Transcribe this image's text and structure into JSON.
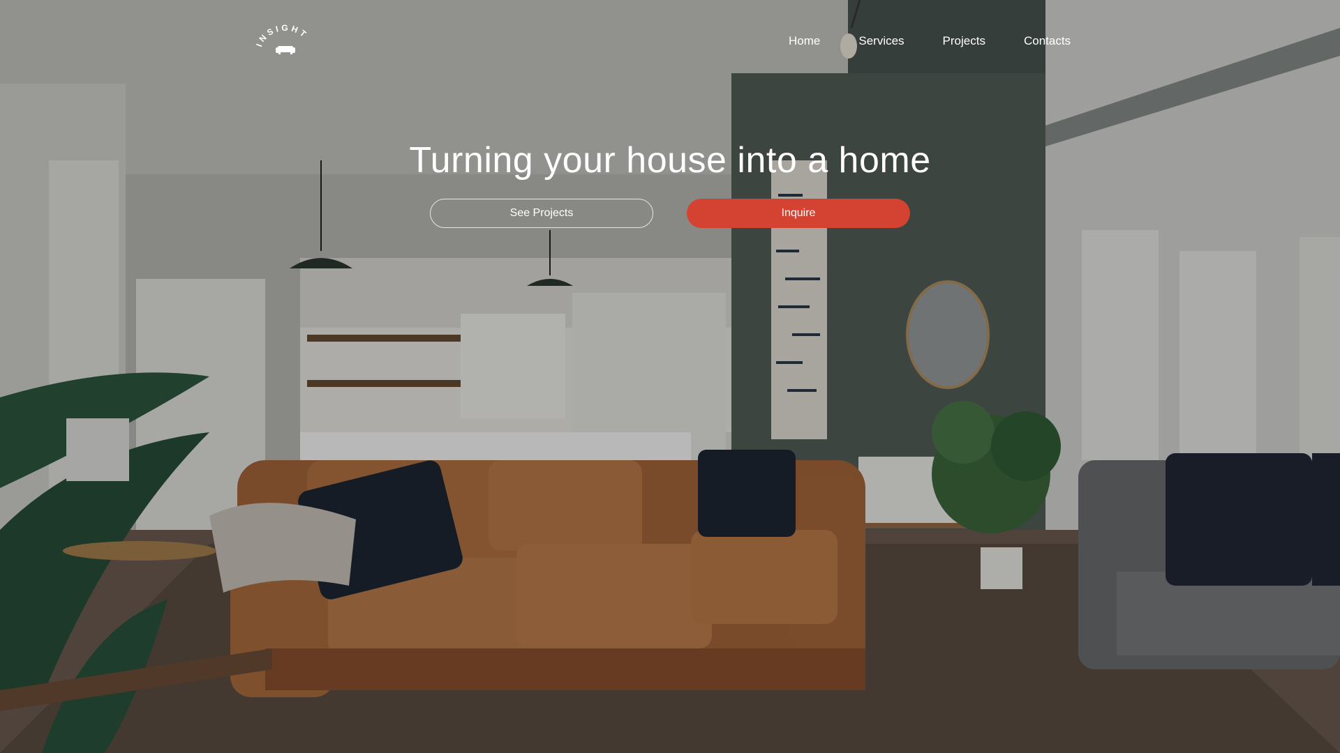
{
  "brand": {
    "logo_text": "INSIGHT",
    "logo_icon": "sofa-icon"
  },
  "nav": {
    "items": [
      {
        "label": "Home"
      },
      {
        "label": "Services"
      },
      {
        "label": "Projects"
      },
      {
        "label": "Contacts"
      }
    ]
  },
  "hero": {
    "headline": "Turning your house into a home",
    "secondary_button": "See Projects",
    "primary_button": "Inquire",
    "background_image": "living-room-photo"
  },
  "colors": {
    "accent": "#d44232",
    "text": "#ffffff",
    "overlay": "rgba(0,0,0,0.28)"
  }
}
